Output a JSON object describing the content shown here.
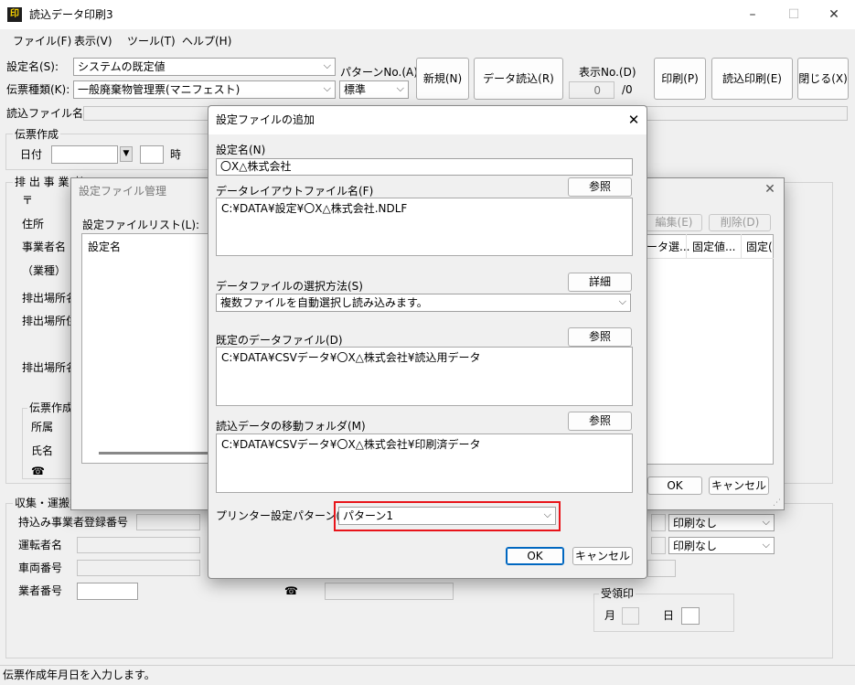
{
  "window": {
    "title": "読込データ印刷3",
    "app_icon": "印",
    "minimize": "–",
    "maximize": "☐",
    "close": "✕"
  },
  "menu": {
    "file": "ファイル(F)",
    "view": "表示(V)",
    "tools": "ツール(T)",
    "help": "ヘルプ(H)"
  },
  "toolbar": {
    "setting_label": "設定名(S):",
    "setting_value": "システムの既定値",
    "slip_type_label": "伝票種類(K):",
    "slip_type_value": "一般廃棄物管理票(マニフェスト)",
    "pattern_label": "パターンNo.(A):",
    "pattern_value": "標準",
    "new_btn": "新規(N)",
    "read_btn": "データ読込(R)",
    "display_no_label": "表示No.(D)",
    "display_no_value": "0",
    "display_no_total": "/0",
    "print_btn": "印刷(P)",
    "read_print_btn": "読込印刷(E)",
    "close_btn": "閉じる(X)"
  },
  "read_file_label": "読込ファイル名",
  "form": {
    "slip_section": "伝票作成",
    "date_label": "日付",
    "hour_label": "時",
    "emitter_section": "排 出 事 業 者",
    "postal_mark": "〒",
    "address": "住所",
    "company": "事業者名",
    "industry": "（業種）",
    "site_name": "排出場所名",
    "site_addr": "排出場所住所",
    "site_other": "排出場所名",
    "creator_section": "伝票作成者",
    "dept": "所属",
    "person": "氏名",
    "phone_icon": "☎",
    "collect_section": "収集・運搬業者",
    "reg_no": "持込み事業者登録番号",
    "driver": "運転者名",
    "vehicle": "車両番号",
    "vendor_no": "業者番号",
    "print_none_1": "印刷なし",
    "print_none_2": "印刷なし",
    "receipt_section": "受領印",
    "month": "月",
    "day": "日"
  },
  "manage_dialog": {
    "title": "設定ファイル管理",
    "list_label": "設定ファイルリスト(L):",
    "list_header": "設定名",
    "edit_btn": "編集(E)",
    "delete_btn": "削除(D)",
    "cols": [
      "ータ選...",
      "固定値...",
      "固定("
    ],
    "ok": "OK",
    "cancel": "キャンセル"
  },
  "add_dialog": {
    "title": "設定ファイルの追加",
    "name_label": "設定名(N)",
    "name_value": "〇X△株式会社",
    "layout_label": "データレイアウトファイル名(F)",
    "layout_value": "C:¥DATA¥設定¥〇X△株式会社.NDLF",
    "browse_1": "参照",
    "select_label": "データファイルの選択方法(S)",
    "detail_btn": "詳細",
    "select_value": "複数ファイルを自動選択し読み込みます。",
    "default_label": "既定のデータファイル(D)",
    "browse_2": "参照",
    "default_value": "C:¥DATA¥CSVデータ¥〇X△株式会社¥読込用データ",
    "move_label": "読込データの移動フォルダ(M)",
    "browse_3": "参照",
    "move_value": "C:¥DATA¥CSVデータ¥〇X△株式会社¥印刷済データ",
    "printer_label": "プリンター設定パターン(P):",
    "printer_value": "パターン1",
    "ok": "OK",
    "cancel": "キャンセル"
  },
  "status_bar": "伝票作成年月日を入力します。",
  "colors": {
    "highlight": "#e8141a",
    "accent": "#0067c0"
  }
}
